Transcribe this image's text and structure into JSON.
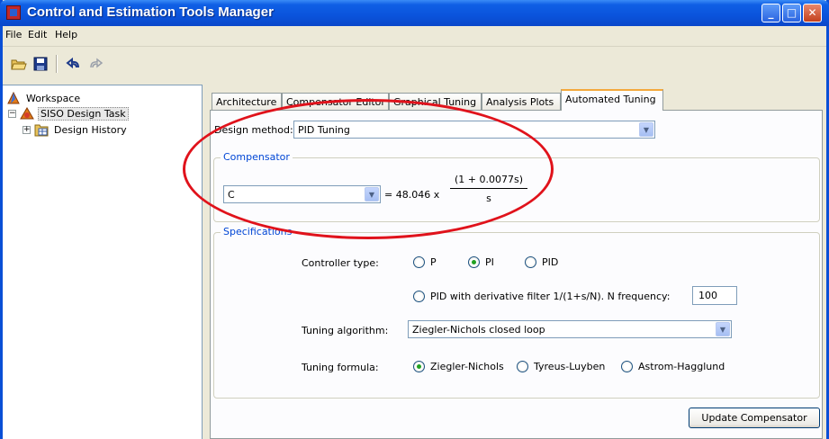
{
  "window": {
    "title": "Control and Estimation Tools Manager",
    "minimize": "_",
    "maximize": "□",
    "close": "✕"
  },
  "menu": [
    "File",
    "Edit",
    "Help"
  ],
  "toolbar": {
    "icons": [
      "open-icon",
      "save-icon",
      "undo-icon",
      "redo-icon"
    ]
  },
  "tree": {
    "workspace": "Workspace",
    "task": "SISO Design Task",
    "history": "Design History",
    "expander_minus": "−",
    "expander_plus": "+"
  },
  "tabs": [
    "Architecture",
    "Compensator Editor",
    "Graphical Tuning",
    "Analysis Plots",
    "Automated Tuning"
  ],
  "active_tab": "Automated Tuning",
  "design": {
    "method_label": "Design method:",
    "method_value": "PID Tuning"
  },
  "compensator": {
    "title": "Compensator",
    "select_value": "C",
    "equals": "= 48.046 x",
    "numerator": "(1 + 0.0077s)",
    "denominator": "s"
  },
  "specifications": {
    "title": "Specifications",
    "controller_type_label": "Controller type:",
    "controller_options": [
      {
        "label": "P",
        "selected": false
      },
      {
        "label": "PI",
        "selected": true
      },
      {
        "label": "PID",
        "selected": false
      }
    ],
    "pid_filter_label": "PID with derivative filter 1/(1+s/N). N frequency:",
    "pid_filter_selected": false,
    "n_frequency": "100",
    "algorithm_label": "Tuning algorithm:",
    "algorithm_value": "Ziegler-Nichols closed loop",
    "formula_label": "Tuning formula:",
    "formula_options": [
      {
        "label": "Ziegler-Nichols",
        "selected": true
      },
      {
        "label": "Tyreus-Luyben",
        "selected": false
      },
      {
        "label": "Astrom-Hagglund",
        "selected": false
      }
    ]
  },
  "update_button": "Update Compensator",
  "colors": {
    "titlebar": "#0a53dc",
    "group_title": "#0046d5",
    "annotation": "#e0121b",
    "active_tab_accent": "#f4a93c"
  }
}
